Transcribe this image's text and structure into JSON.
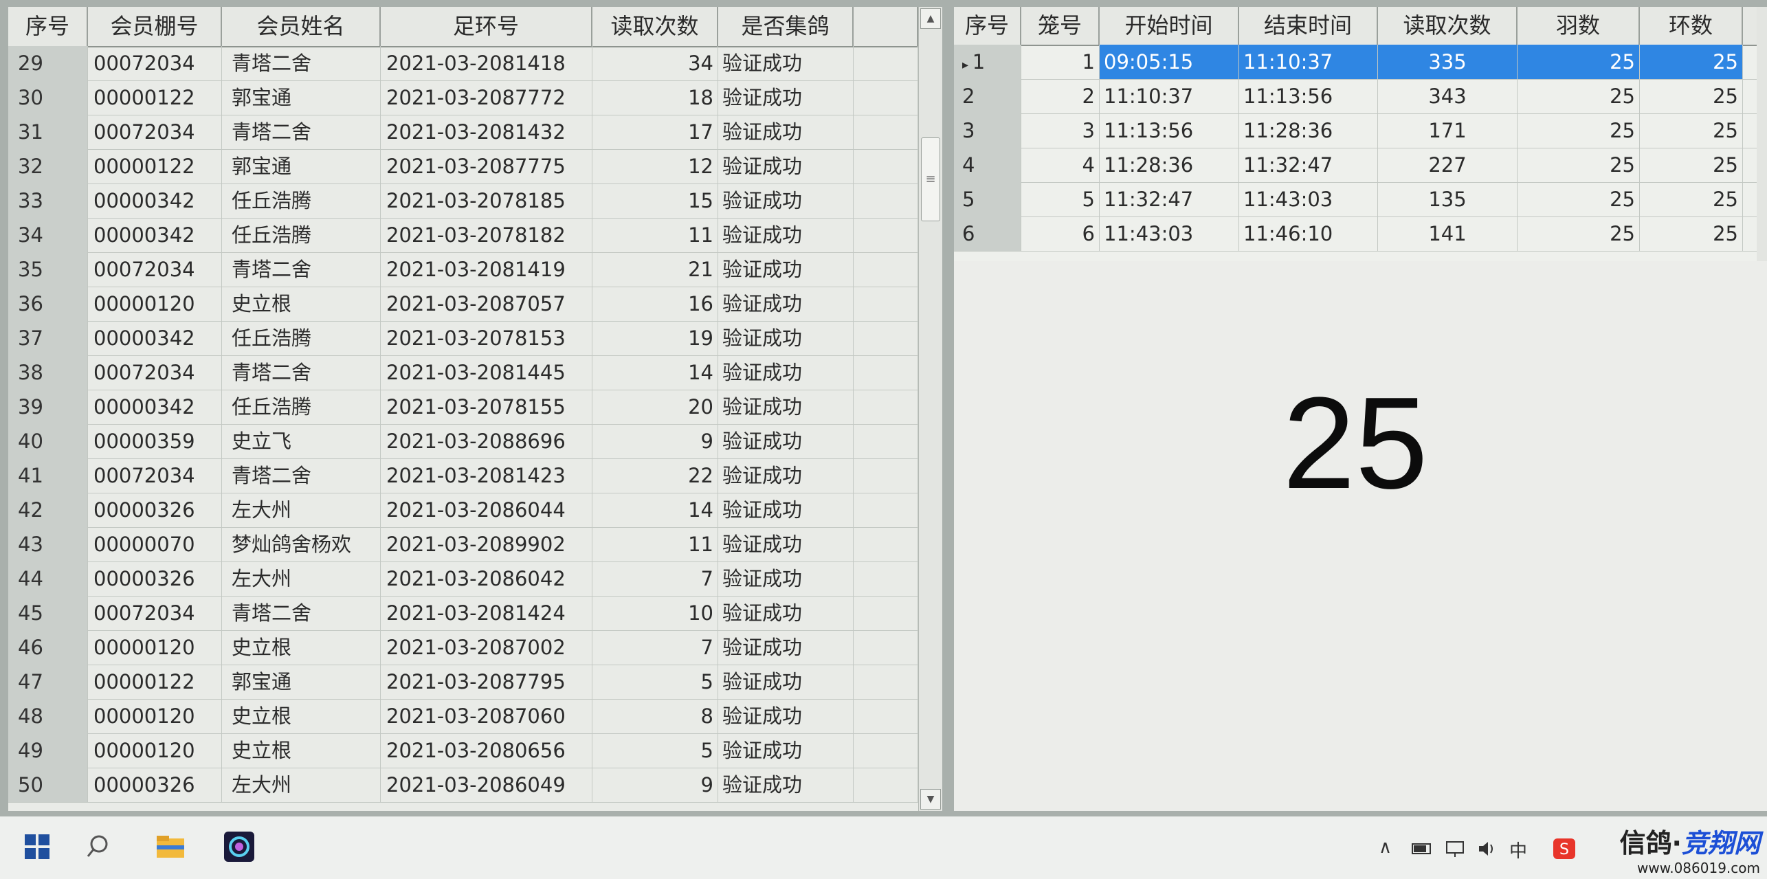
{
  "left_table": {
    "columns": [
      "序号",
      "会员棚号",
      "会员姓名",
      "足环号",
      "读取次数",
      "是否集鸽"
    ],
    "rows": [
      [
        "29",
        "00072034",
        "青塔二舍",
        "2021-03-2081418",
        "34",
        "验证成功"
      ],
      [
        "30",
        "00000122",
        "郭宝通",
        "2021-03-2087772",
        "18",
        "验证成功"
      ],
      [
        "31",
        "00072034",
        "青塔二舍",
        "2021-03-2081432",
        "17",
        "验证成功"
      ],
      [
        "32",
        "00000122",
        "郭宝通",
        "2021-03-2087775",
        "12",
        "验证成功"
      ],
      [
        "33",
        "00000342",
        "任丘浩腾",
        "2021-03-2078185",
        "15",
        "验证成功"
      ],
      [
        "34",
        "00000342",
        "任丘浩腾",
        "2021-03-2078182",
        "11",
        "验证成功"
      ],
      [
        "35",
        "00072034",
        "青塔二舍",
        "2021-03-2081419",
        "21",
        "验证成功"
      ],
      [
        "36",
        "00000120",
        "史立根",
        "2021-03-2087057",
        "16",
        "验证成功"
      ],
      [
        "37",
        "00000342",
        "任丘浩腾",
        "2021-03-2078153",
        "19",
        "验证成功"
      ],
      [
        "38",
        "00072034",
        "青塔二舍",
        "2021-03-2081445",
        "14",
        "验证成功"
      ],
      [
        "39",
        "00000342",
        "任丘浩腾",
        "2021-03-2078155",
        "20",
        "验证成功"
      ],
      [
        "40",
        "00000359",
        "史立飞",
        "2021-03-2088696",
        "9",
        "验证成功"
      ],
      [
        "41",
        "00072034",
        "青塔二舍",
        "2021-03-2081423",
        "22",
        "验证成功"
      ],
      [
        "42",
        "00000326",
        "左大州",
        "2021-03-2086044",
        "14",
        "验证成功"
      ],
      [
        "43",
        "00000070",
        "梦灿鸽舍杨欢",
        "2021-03-2089902",
        "11",
        "验证成功"
      ],
      [
        "44",
        "00000326",
        "左大州",
        "2021-03-2086042",
        "7",
        "验证成功"
      ],
      [
        "45",
        "00072034",
        "青塔二舍",
        "2021-03-2081424",
        "10",
        "验证成功"
      ],
      [
        "46",
        "00000120",
        "史立根",
        "2021-03-2087002",
        "7",
        "验证成功"
      ],
      [
        "47",
        "00000122",
        "郭宝通",
        "2021-03-2087795",
        "5",
        "验证成功"
      ],
      [
        "48",
        "00000120",
        "史立根",
        "2021-03-2087060",
        "8",
        "验证成功"
      ],
      [
        "49",
        "00000120",
        "史立根",
        "2021-03-2080656",
        "5",
        "验证成功"
      ],
      [
        "50",
        "00000326",
        "左大州",
        "2021-03-2086049",
        "9",
        "验证成功"
      ]
    ]
  },
  "right_table": {
    "columns": [
      "序号",
      "笼号",
      "开始时间",
      "结束时间",
      "读取次数",
      "羽数",
      "环数"
    ],
    "rows": [
      [
        "1",
        "1",
        "09:05:15",
        "11:10:37",
        "335",
        "25",
        "25"
      ],
      [
        "2",
        "2",
        "11:10:37",
        "11:13:56",
        "343",
        "25",
        "25"
      ],
      [
        "3",
        "3",
        "11:13:56",
        "11:28:36",
        "171",
        "25",
        "25"
      ],
      [
        "4",
        "4",
        "11:28:36",
        "11:32:47",
        "227",
        "25",
        "25"
      ],
      [
        "5",
        "5",
        "11:32:47",
        "11:43:03",
        "135",
        "25",
        "25"
      ],
      [
        "6",
        "6",
        "11:43:03",
        "11:46:10",
        "141",
        "25",
        "25"
      ]
    ],
    "selected_row": 0
  },
  "big_display": "25",
  "taskbar": {
    "icons": [
      "windows-start-icon",
      "search-icon",
      "file-explorer-icon",
      "app-icon"
    ],
    "tray": [
      "chevron-up-icon",
      "battery-icon",
      "network-icon",
      "volume-icon",
      "ime-icon",
      "sogou-icon"
    ],
    "watermark_title_prefix": "信鸽·",
    "watermark_title_brand": "竞翔网",
    "watermark_url": "www.086019.com"
  },
  "colors": {
    "selection": "#2f86e3",
    "background": "#ecedea"
  }
}
